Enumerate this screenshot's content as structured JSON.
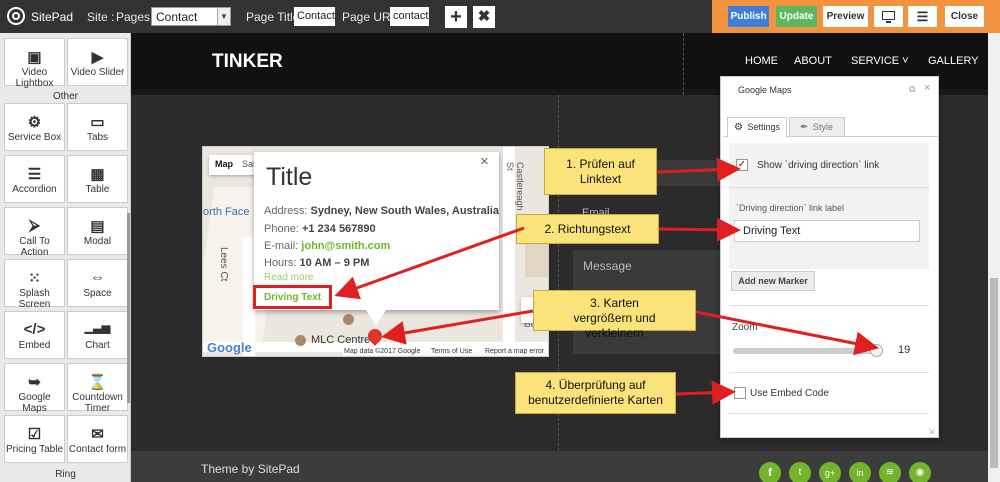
{
  "topbar": {
    "app_name": "SitePad",
    "site_label": "Site :",
    "pages_label": "Pages :",
    "pages_value": "Contact",
    "page_title_label": "Page Title:",
    "page_title_value": "Contact",
    "page_url_label": "Page URL:",
    "page_url_value": "contact",
    "add_icon": "+",
    "remove_icon": "✖",
    "publish": "Publish",
    "update": "Update",
    "preview": "Preview",
    "close": "Close"
  },
  "sidebar": {
    "row0": [
      {
        "icon": "▣",
        "label": "Video Lightbox"
      },
      {
        "icon": "▶",
        "label": "Video Slider"
      }
    ],
    "section_other": "Other",
    "items": [
      {
        "icon": "⚙",
        "label": "Service Box"
      },
      {
        "icon": "▭",
        "label": "Tabs"
      },
      {
        "icon": "☰",
        "label": "Accordion"
      },
      {
        "icon": "▦",
        "label": "Table"
      },
      {
        "icon": "⮚",
        "label": "Call To Action"
      },
      {
        "icon": "▤",
        "label": "Modal"
      },
      {
        "icon": "⁙",
        "label": "Splash Screen"
      },
      {
        "icon": "⇔",
        "label": "Space"
      },
      {
        "icon": "</>",
        "label": "Embed"
      },
      {
        "icon": "▁▃▅",
        "label": "Chart"
      },
      {
        "icon": "➥",
        "label": "Google Maps"
      },
      {
        "icon": "⌛",
        "label": "Countdown Timer"
      },
      {
        "icon": "☑",
        "label": "Pricing Table"
      },
      {
        "icon": "✉",
        "label": "Contact form"
      }
    ],
    "section_ring": "Ring"
  },
  "site": {
    "brand": "TINKER",
    "nav": [
      "HOME",
      "ABOUT",
      "SERVICE ˅",
      "GALLERY"
    ],
    "footer_text": "Theme by SitePad",
    "form_email": "Email",
    "form_message": "Message"
  },
  "map": {
    "tab_map": "Map",
    "tab_satellite": "Satellite",
    "title": "Title",
    "address_label": "Address:",
    "address_value": "Sydney, New South Wales, Australia",
    "phone_label": "Phone:",
    "phone_value": "+1 234 567890",
    "email_label": "E-mail:",
    "email_value": "john@smith.com",
    "hours_label": "Hours:",
    "hours_value": "10 AM – 9 PM",
    "read_more": "Read more",
    "driving_text": "Driving Text",
    "street_north_face": "orth Face",
    "street_lees": "Lees Ct",
    "street_castlereagh": "Castlereagh St",
    "mlc": "MLC Centre",
    "bulga": "Bulga",
    "google_logo": "Google",
    "map_data": "Map data ©2017 Google",
    "terms": "Terms of Use",
    "report": "Report a map error",
    "close_x": "×"
  },
  "panel": {
    "title": "Google Maps",
    "tab_settings": "Settings",
    "tab_style": "Style",
    "show_link_label": "Show `driving direction` link",
    "link_label_caption": "`Driving direction` link label",
    "link_label_value": "Driving Text",
    "add_marker": "Add new Marker",
    "zoom_label": "Zoom",
    "zoom_value": "19",
    "zoom_fraction": 0.95,
    "embed_label": "Use Embed Code"
  },
  "notes": {
    "n1": "1. Prüfen auf Linktext",
    "n2": "2. Richtungstext",
    "n3": "3. Karten vergrößern und verkleinern",
    "n4": "4. Überprüfung auf benutzerdefinierte Karten"
  },
  "colors": {
    "accent_orange": "#f29340",
    "publish_blue": "#3f7fd6",
    "update_green": "#5cb85c",
    "link_green": "#74b42d",
    "arrow_red": "#e02020",
    "note_yellow": "#fbe27a"
  }
}
